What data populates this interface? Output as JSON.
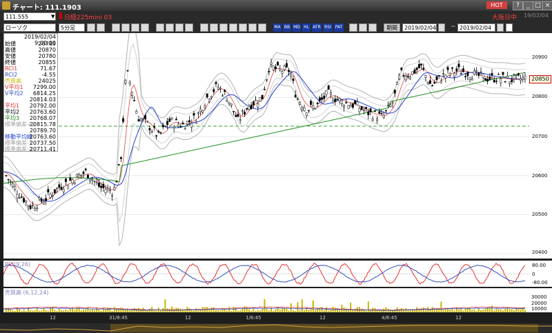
{
  "window": {
    "title": "チャート: 111.1903",
    "hot_label": "HOT"
  },
  "toolbar1": {
    "symbol_code": "111.555",
    "instrument": "日経225mini 03",
    "market_status": "大阪日中",
    "market_date": "19/02/04"
  },
  "toolbar2": {
    "chart_type": "ローソク",
    "interval": "5分足",
    "period_label": "期間",
    "date_from": "2019/02/04",
    "date_to": "2019/02/04",
    "range_sep": "~"
  },
  "info_panel": {
    "datetime": "2019/02/04 9:00:00",
    "rows": [
      {
        "label": "始値",
        "value": "20785",
        "color": "#000000"
      },
      {
        "label": "高値",
        "value": "20870",
        "color": "#000000"
      },
      {
        "label": "安値",
        "value": "20780",
        "color": "#000000"
      },
      {
        "label": "終値",
        "value": "20855",
        "color": "#000000"
      },
      {
        "label": "RCI1",
        "value": "71.67",
        "color": "#e03030"
      },
      {
        "label": "RCI2",
        "value": "-4.55",
        "color": "#3050c0"
      },
      {
        "label": "売買高",
        "value": "24025",
        "color": "#c8b400"
      },
      {
        "label": "V平均1",
        "value": "7299.00",
        "color": "#e03030"
      },
      {
        "label": "V平均2",
        "value": "6814.25",
        "color": "#3050c0"
      },
      {
        "label": "",
        "value": "20814.03",
        "color": "#000000"
      },
      {
        "label": "平均1",
        "value": "20792.00",
        "color": "#e03030"
      },
      {
        "label": "平均2",
        "value": "20763.60",
        "color": "#000000"
      },
      {
        "label": "平均3",
        "value": "20768.07",
        "color": "#208020"
      },
      {
        "label": "標準偏差+2",
        "value": "20815.78",
        "color": "#a0a0a0"
      },
      {
        "label": "",
        "value": "20789.70",
        "color": "#000000"
      },
      {
        "label": "移動平均線",
        "value": "20763.60",
        "color": "#2040d0"
      },
      {
        "label": "標準偏差-1",
        "value": "20737.50",
        "color": "#a0a0a0"
      },
      {
        "label": "標準偏差-2",
        "value": "20711.41",
        "color": "#a0a0a0"
      }
    ]
  },
  "main_axis": {
    "ticks": [
      "20900",
      "20800",
      "20700",
      "20600",
      "20500",
      "20400"
    ],
    "current_price": "20850"
  },
  "rci_pane": {
    "label": "RCI(9,26)",
    "ticks": [
      "80.00",
      "0",
      "-80.00"
    ]
  },
  "volume_pane": {
    "label": "売買高 (6,12,24)",
    "ticks": [
      "30000",
      "20000",
      "10000"
    ]
  },
  "x_axis": {
    "ticks": [
      "12",
      "31/8:45",
      "12",
      "1/8:45",
      "12",
      "4/8:45",
      "12"
    ]
  },
  "colors": {
    "candle_up": "#ffffff",
    "candle_down": "#000000",
    "rci1": "#e03030",
    "rci2": "#3050c0",
    "ma_blue": "#2040d0",
    "ma_green": "#209020",
    "ma_red": "#e04040",
    "band": "#b0b0b0",
    "dashed": "#30a030"
  }
}
